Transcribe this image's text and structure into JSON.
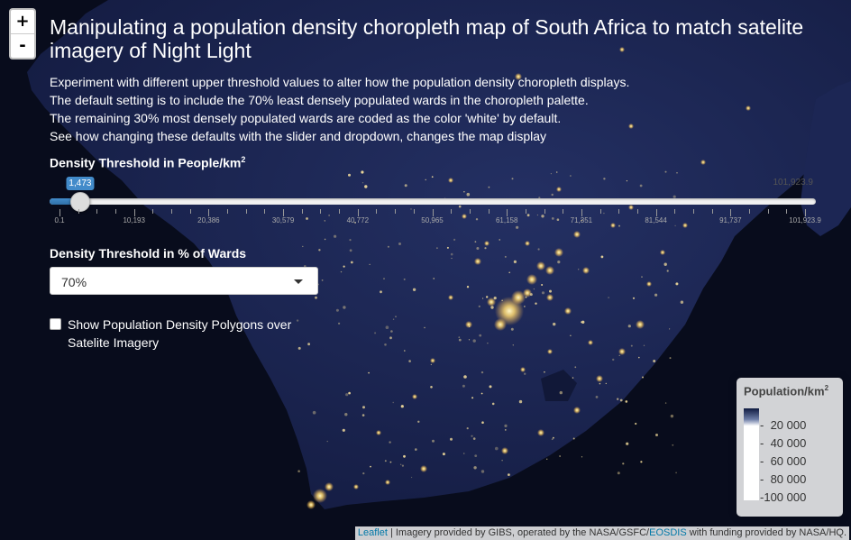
{
  "zoom": {
    "in_label": "+",
    "out_label": "-"
  },
  "title": "Manipulating a population density choropleth map of South Africa to match satelite imagery of Night Light",
  "intro": [
    "Experiment with different upper threshold values to alter how the population density choropleth displays.",
    "The default setting is to include the 70% least densely populated wards in the choropleth palette.",
    "The remaining 30% most densely populated wards are coded as the color 'white' by default.",
    "See how changing these defaults with the slider and dropdown, changes the map display"
  ],
  "density_threshold": {
    "label": "Density Threshold in People/km",
    "sup": "2",
    "min": 0.1,
    "max": 101923.9,
    "value": 1473,
    "value_label": "1,473",
    "max_label": "101,923.9",
    "tick_labels": [
      "0.1",
      "10,193",
      "20,386",
      "30,579",
      "40,772",
      "50,965",
      "61,158",
      "71,351",
      "81,544",
      "91,737",
      "101,923.9"
    ]
  },
  "percent_threshold": {
    "label": "Density Threshold in % of Wards",
    "selected": "70%"
  },
  "polygons_toggle": {
    "label": "Show Population Density Polygons over Satelite Imagery",
    "checked": false
  },
  "legend": {
    "title": "Population/km",
    "sup": "2",
    "entries": [
      "20 000",
      "40 000",
      "60 000",
      "80 000",
      "100 000"
    ]
  },
  "attribution": {
    "leaflet": "Leaflet",
    "middle": " | Imagery provided by GIBS, operated by the NASA/GSFC/",
    "eosdis": "EOSDIS",
    "end": " with funding provided by NASA/HQ."
  },
  "colors": {
    "ocean": "#080c1c",
    "land": "#1a2450",
    "lights": "#ffe9a0",
    "slider_fill": "#428bca"
  }
}
